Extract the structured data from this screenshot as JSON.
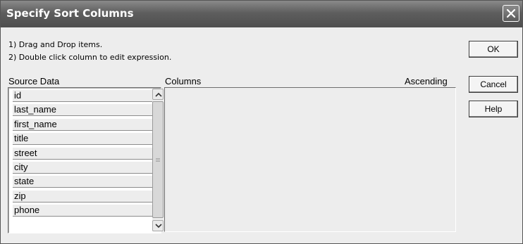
{
  "dialog": {
    "title": "Specify Sort Columns",
    "close_icon": "close-icon"
  },
  "instructions": [
    "1) Drag and Drop items.",
    "2) Double click column to edit expression."
  ],
  "source": {
    "label": "Source Data",
    "items": [
      "id",
      "last_name",
      "first_name",
      "title",
      "street",
      "city",
      "state",
      "zip",
      "phone"
    ]
  },
  "columns": {
    "label": "Columns",
    "ascending_label": "Ascending",
    "items": []
  },
  "buttons": {
    "ok": "OK",
    "cancel": "Cancel",
    "help": "Help"
  }
}
